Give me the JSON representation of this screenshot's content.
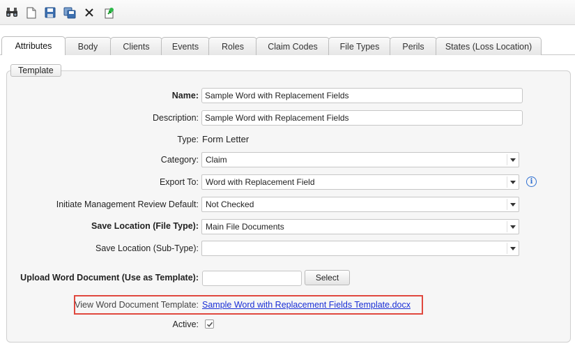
{
  "toolbar": {
    "buttons": [
      {
        "name": "search-icon"
      },
      {
        "name": "new-document-icon"
      },
      {
        "name": "save-icon"
      },
      {
        "name": "save-all-icon"
      },
      {
        "name": "close-icon"
      },
      {
        "name": "export-icon"
      }
    ]
  },
  "tabs": [
    {
      "label": "Attributes",
      "active": true
    },
    {
      "label": "Body"
    },
    {
      "label": "Clients"
    },
    {
      "label": "Events"
    },
    {
      "label": "Roles"
    },
    {
      "label": "Claim Codes"
    },
    {
      "label": "File Types"
    },
    {
      "label": "Perils"
    },
    {
      "label": "States (Loss Location)"
    }
  ],
  "section": {
    "legend": "Template"
  },
  "form": {
    "name": {
      "label": "Name:",
      "value": "Sample Word with Replacement Fields"
    },
    "description": {
      "label": "Description:",
      "value": "Sample Word with Replacement Fields"
    },
    "type": {
      "label": "Type:",
      "value": "Form Letter"
    },
    "category": {
      "label": "Category:",
      "value": "Claim"
    },
    "export_to": {
      "label": "Export To:",
      "value": "Word with Replacement Field"
    },
    "review_default": {
      "label": "Initiate Management Review Default:",
      "value": "Not Checked"
    },
    "save_location": {
      "label": "Save Location (File Type):",
      "value": "Main File Documents"
    },
    "save_subtype": {
      "label": "Save Location (Sub-Type):",
      "value": ""
    },
    "upload": {
      "label": "Upload Word Document (Use as Template):",
      "value": "",
      "button": "Select"
    },
    "view_template": {
      "label": "View Word Document Template:",
      "link": "Sample Word with Replacement Fields Template.docx"
    },
    "active": {
      "label": "Active:",
      "checked": true
    }
  },
  "colors": {
    "highlight": "#e0483e",
    "link": "#1a2fd6",
    "info": "#2e6fd1"
  }
}
